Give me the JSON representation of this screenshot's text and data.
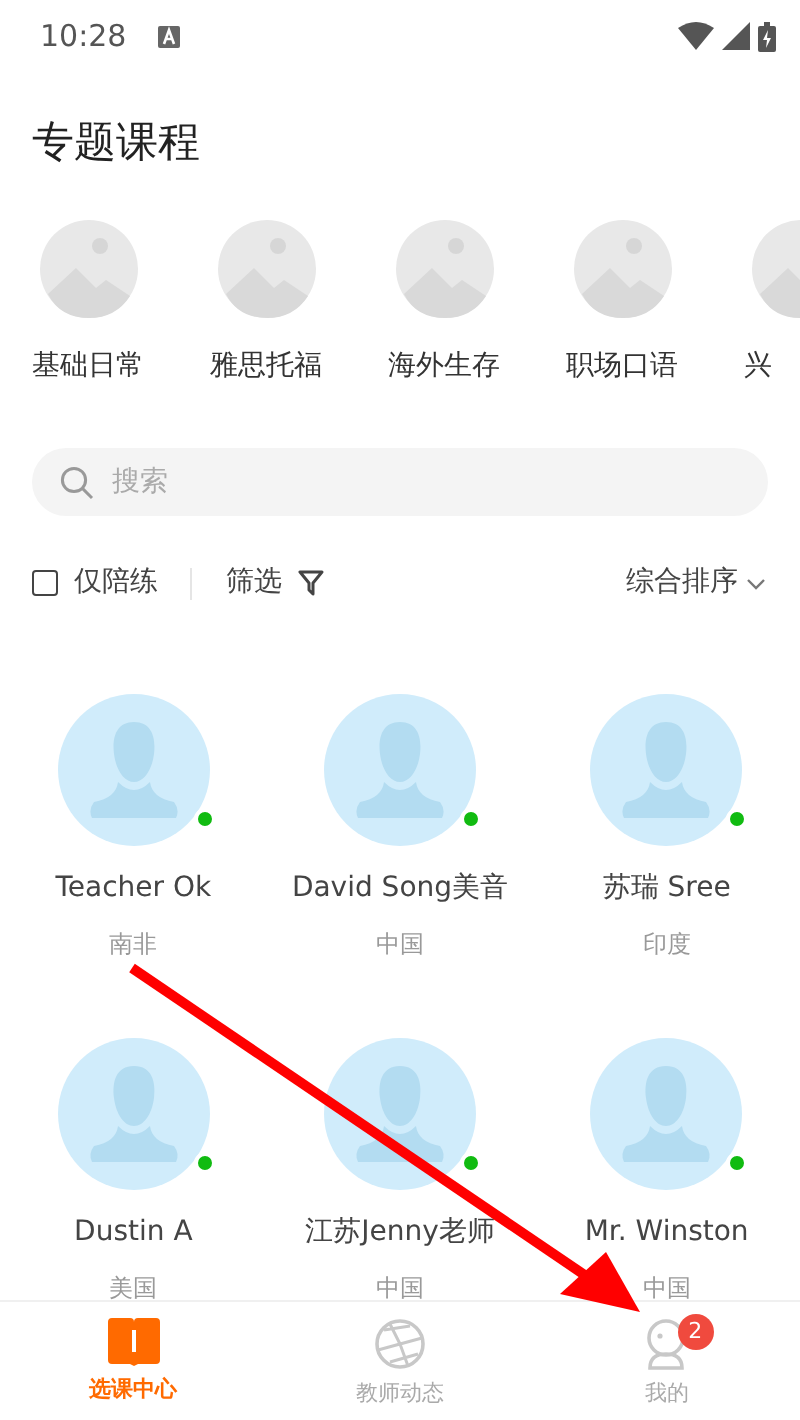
{
  "status_bar": {
    "time": "10:28"
  },
  "title": "专题课程",
  "categories": [
    {
      "label": "基础日常"
    },
    {
      "label": "雅思托福"
    },
    {
      "label": "海外生存"
    },
    {
      "label": "职场口语"
    },
    {
      "label": "兴"
    }
  ],
  "search": {
    "placeholder": "搜索"
  },
  "filters": {
    "only_practice": {
      "label": "仅陪练",
      "checked": false
    },
    "filter_label": "筛选",
    "sort_label": "综合排序"
  },
  "teachers": [
    {
      "name": "Teacher Ok",
      "country": "南非",
      "online": true
    },
    {
      "name": "David Song美音",
      "country": "中国",
      "online": true
    },
    {
      "name": "苏瑞 Sree",
      "country": "印度",
      "online": true
    },
    {
      "name": "Dustin A",
      "country": "美国",
      "online": true
    },
    {
      "name": "江苏Jenny老师",
      "country": "中国",
      "online": true
    },
    {
      "name": "Mr. Winston",
      "country": "中国",
      "online": true
    }
  ],
  "tab_bar": [
    {
      "label": "选课中心",
      "selected": true
    },
    {
      "label": "教师动态",
      "selected": false
    },
    {
      "label": "我的",
      "selected": false,
      "badge": "2"
    }
  ]
}
